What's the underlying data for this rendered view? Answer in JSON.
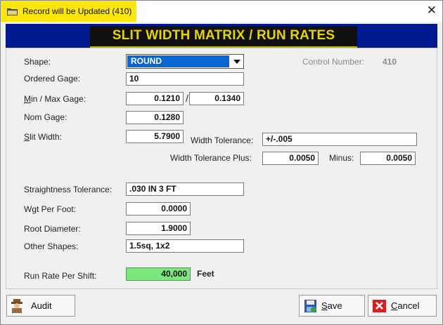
{
  "window": {
    "title": "Record will be Updated  (410)",
    "close_glyph": "✕",
    "title_icon": "folder-icon"
  },
  "banner": {
    "text": "SLIT WIDTH MATRIX  / RUN RATES"
  },
  "form": {
    "shape_label": "Shape:",
    "shape_value": "ROUND",
    "control_number_label": "Control Number:",
    "control_number_value": "410",
    "ordered_gage_label": "Ordered Gage:",
    "ordered_gage_value": "10",
    "min_max_gage_label_u": "M",
    "min_max_gage_label_rest": "in / Max Gage:",
    "min_gage_value": "0.1210",
    "max_gage_value": "0.1340",
    "slash": "/",
    "nom_gage_label": "Nom Gage:",
    "nom_gage_value": "0.1280",
    "slit_width_label_u": "S",
    "slit_width_label_rest": "lit Width:",
    "slit_width_value": "5.7900",
    "width_tolerance_label": "Width Tolerance:",
    "width_tolerance_value": "+/-.005",
    "width_tol_plus_label": "Width Tolerance Plus:",
    "width_tol_plus_value": "0.0050",
    "minus_label": "Minus:",
    "minus_value": "0.0050",
    "straightness_label": "Straightness Tolerance:",
    "straightness_value": ".030 IN 3 FT",
    "wgt_per_foot_label": "Wgt Per Foot:",
    "wgt_per_foot_value": "0.0000",
    "root_diameter_label": "Root Diameter:",
    "root_diameter_value": "1.9000",
    "other_shapes_label": "Other Shapes:",
    "other_shapes_value": "1.5sq, 1x2",
    "run_rate_label": "Run Rate Per Shift:",
    "run_rate_value": "40,000",
    "run_rate_unit": "Feet"
  },
  "buttons": {
    "audit": "Audit",
    "save_u": "S",
    "save_rest": "ave",
    "cancel_u": "C",
    "cancel_rest": "ancel"
  },
  "colors": {
    "title_tab": "#ffe60a",
    "banner_bg": "#001b8f",
    "banner_text": "#e6d400",
    "selected_blue": "#0a66d0",
    "run_rate_green": "#7ce87c"
  }
}
